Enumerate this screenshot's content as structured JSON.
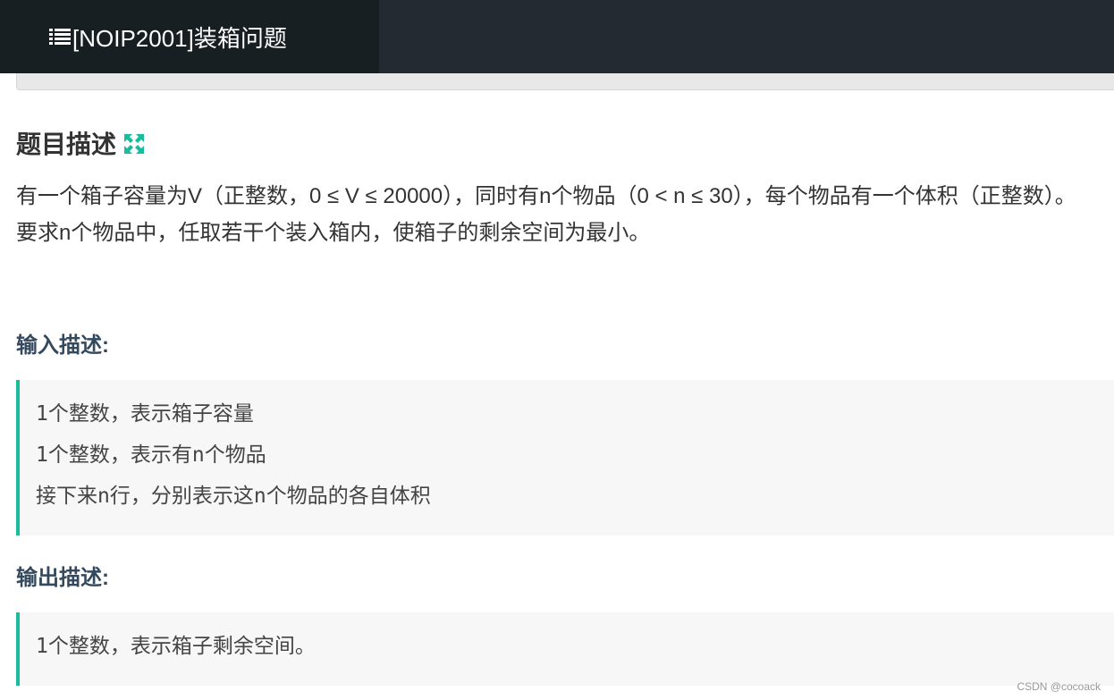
{
  "header": {
    "title": "[NOIP2001]装箱问题",
    "icon": "list-icon"
  },
  "problem": {
    "heading": "题目描述",
    "heading_icon": "expand-icon",
    "accent_color": "#1abc9c",
    "desc_line1": "有一个箱子容量为V（正整数，0 ≤ V ≤ 20000），同时有n个物品（0 < n ≤ 30），每个物品有一个体积（正整数）。",
    "desc_line2": "要求n个物品中，任取若干个装入箱内，使箱子的剩余空间为最小。"
  },
  "input": {
    "heading": "输入描述:",
    "lines": [
      "1个整数，表示箱子容量",
      "1个整数，表示有n个物品",
      "接下来n行，分别表示这n个物品的各自体积"
    ]
  },
  "output": {
    "heading": "输出描述:",
    "lines": [
      "1个整数，表示箱子剩余空间。"
    ]
  },
  "watermark": "CSDN @cocoack"
}
